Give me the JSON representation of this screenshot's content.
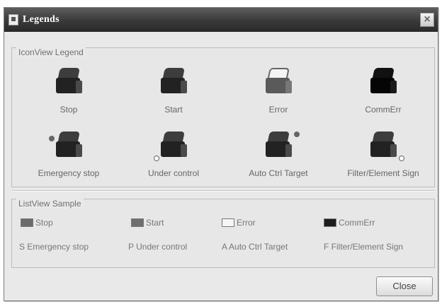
{
  "window": {
    "title": "Legends",
    "close_glyph": "×"
  },
  "icon_view": {
    "title": "IconView Legend",
    "items": [
      {
        "label": "Stop",
        "icon": "device-icon",
        "variant": "dark"
      },
      {
        "label": "Start",
        "icon": "device-icon",
        "variant": "dark"
      },
      {
        "label": "Error",
        "icon": "device-icon",
        "variant": "light"
      },
      {
        "label": "CommErr",
        "icon": "device-icon",
        "variant": "black"
      },
      {
        "label": "Emergency stop",
        "icon": "device-icon",
        "variant": "dark",
        "marker": "dot"
      },
      {
        "label": "Under control",
        "icon": "device-icon",
        "variant": "dark",
        "marker": "ring"
      },
      {
        "label": "Auto Ctrl Target",
        "icon": "device-icon",
        "variant": "dark",
        "marker": "dot"
      },
      {
        "label": "Filter/Element Sign",
        "icon": "device-icon",
        "variant": "dark",
        "marker": "ring"
      }
    ]
  },
  "list_view": {
    "title": "ListView Sample",
    "items": [
      {
        "text": "Stop",
        "swatch": "stop"
      },
      {
        "text": "Start",
        "swatch": "start"
      },
      {
        "text": "Error",
        "swatch": "error"
      },
      {
        "text": "CommErr",
        "swatch": "comm"
      },
      {
        "text": "S Emergency stop"
      },
      {
        "text": "P Under control"
      },
      {
        "text": "A Auto Ctrl Target"
      },
      {
        "text": "F Filter/Element Sign"
      }
    ]
  },
  "buttons": {
    "close": "Close"
  }
}
